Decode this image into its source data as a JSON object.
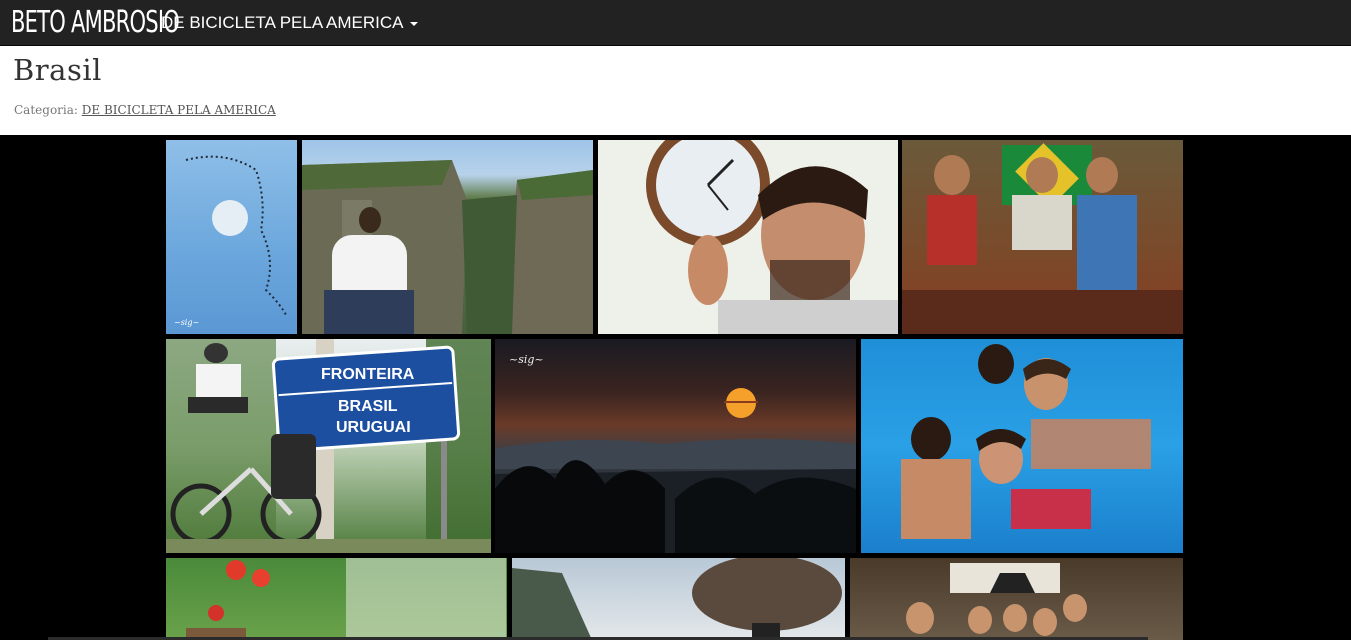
{
  "navbar": {
    "brand": "BETO AMBROSIO",
    "menu_label": "DE BICICLETA PELA AMERICA"
  },
  "page": {
    "title": "Brasil",
    "category_label": "Categoria:",
    "category_link": "DE BICICLETA PELA AMERICA"
  },
  "photos": {
    "sign_line1": "FRONTEIRA",
    "sign_line2": "BRASIL",
    "sign_line3": "URUGUAI"
  },
  "colors": {
    "navbar_bg": "#222222",
    "gallery_bg": "#000000",
    "header_bg": "#ffffff"
  }
}
